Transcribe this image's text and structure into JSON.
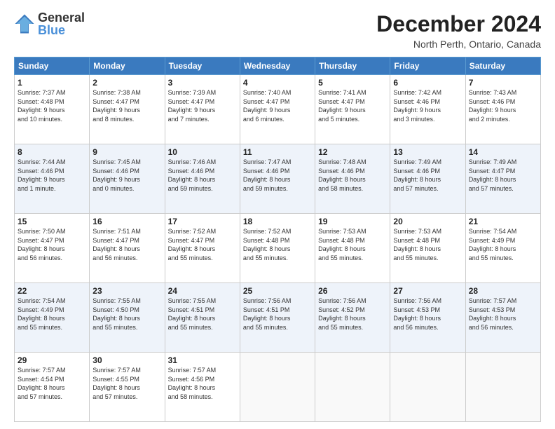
{
  "header": {
    "logo_line1": "General",
    "logo_line2": "Blue",
    "month_title": "December 2024",
    "location": "North Perth, Ontario, Canada"
  },
  "days_of_week": [
    "Sunday",
    "Monday",
    "Tuesday",
    "Wednesday",
    "Thursday",
    "Friday",
    "Saturday"
  ],
  "weeks": [
    [
      {
        "day": "1",
        "lines": [
          "Sunrise: 7:37 AM",
          "Sunset: 4:48 PM",
          "Daylight: 9 hours",
          "and 10 minutes."
        ]
      },
      {
        "day": "2",
        "lines": [
          "Sunrise: 7:38 AM",
          "Sunset: 4:47 PM",
          "Daylight: 9 hours",
          "and 8 minutes."
        ]
      },
      {
        "day": "3",
        "lines": [
          "Sunrise: 7:39 AM",
          "Sunset: 4:47 PM",
          "Daylight: 9 hours",
          "and 7 minutes."
        ]
      },
      {
        "day": "4",
        "lines": [
          "Sunrise: 7:40 AM",
          "Sunset: 4:47 PM",
          "Daylight: 9 hours",
          "and 6 minutes."
        ]
      },
      {
        "day": "5",
        "lines": [
          "Sunrise: 7:41 AM",
          "Sunset: 4:47 PM",
          "Daylight: 9 hours",
          "and 5 minutes."
        ]
      },
      {
        "day": "6",
        "lines": [
          "Sunrise: 7:42 AM",
          "Sunset: 4:46 PM",
          "Daylight: 9 hours",
          "and 3 minutes."
        ]
      },
      {
        "day": "7",
        "lines": [
          "Sunrise: 7:43 AM",
          "Sunset: 4:46 PM",
          "Daylight: 9 hours",
          "and 2 minutes."
        ]
      }
    ],
    [
      {
        "day": "8",
        "lines": [
          "Sunrise: 7:44 AM",
          "Sunset: 4:46 PM",
          "Daylight: 9 hours",
          "and 1 minute."
        ]
      },
      {
        "day": "9",
        "lines": [
          "Sunrise: 7:45 AM",
          "Sunset: 4:46 PM",
          "Daylight: 9 hours",
          "and 0 minutes."
        ]
      },
      {
        "day": "10",
        "lines": [
          "Sunrise: 7:46 AM",
          "Sunset: 4:46 PM",
          "Daylight: 8 hours",
          "and 59 minutes."
        ]
      },
      {
        "day": "11",
        "lines": [
          "Sunrise: 7:47 AM",
          "Sunset: 4:46 PM",
          "Daylight: 8 hours",
          "and 59 minutes."
        ]
      },
      {
        "day": "12",
        "lines": [
          "Sunrise: 7:48 AM",
          "Sunset: 4:46 PM",
          "Daylight: 8 hours",
          "and 58 minutes."
        ]
      },
      {
        "day": "13",
        "lines": [
          "Sunrise: 7:49 AM",
          "Sunset: 4:46 PM",
          "Daylight: 8 hours",
          "and 57 minutes."
        ]
      },
      {
        "day": "14",
        "lines": [
          "Sunrise: 7:49 AM",
          "Sunset: 4:47 PM",
          "Daylight: 8 hours",
          "and 57 minutes."
        ]
      }
    ],
    [
      {
        "day": "15",
        "lines": [
          "Sunrise: 7:50 AM",
          "Sunset: 4:47 PM",
          "Daylight: 8 hours",
          "and 56 minutes."
        ]
      },
      {
        "day": "16",
        "lines": [
          "Sunrise: 7:51 AM",
          "Sunset: 4:47 PM",
          "Daylight: 8 hours",
          "and 56 minutes."
        ]
      },
      {
        "day": "17",
        "lines": [
          "Sunrise: 7:52 AM",
          "Sunset: 4:47 PM",
          "Daylight: 8 hours",
          "and 55 minutes."
        ]
      },
      {
        "day": "18",
        "lines": [
          "Sunrise: 7:52 AM",
          "Sunset: 4:48 PM",
          "Daylight: 8 hours",
          "and 55 minutes."
        ]
      },
      {
        "day": "19",
        "lines": [
          "Sunrise: 7:53 AM",
          "Sunset: 4:48 PM",
          "Daylight: 8 hours",
          "and 55 minutes."
        ]
      },
      {
        "day": "20",
        "lines": [
          "Sunrise: 7:53 AM",
          "Sunset: 4:48 PM",
          "Daylight: 8 hours",
          "and 55 minutes."
        ]
      },
      {
        "day": "21",
        "lines": [
          "Sunrise: 7:54 AM",
          "Sunset: 4:49 PM",
          "Daylight: 8 hours",
          "and 55 minutes."
        ]
      }
    ],
    [
      {
        "day": "22",
        "lines": [
          "Sunrise: 7:54 AM",
          "Sunset: 4:49 PM",
          "Daylight: 8 hours",
          "and 55 minutes."
        ]
      },
      {
        "day": "23",
        "lines": [
          "Sunrise: 7:55 AM",
          "Sunset: 4:50 PM",
          "Daylight: 8 hours",
          "and 55 minutes."
        ]
      },
      {
        "day": "24",
        "lines": [
          "Sunrise: 7:55 AM",
          "Sunset: 4:51 PM",
          "Daylight: 8 hours",
          "and 55 minutes."
        ]
      },
      {
        "day": "25",
        "lines": [
          "Sunrise: 7:56 AM",
          "Sunset: 4:51 PM",
          "Daylight: 8 hours",
          "and 55 minutes."
        ]
      },
      {
        "day": "26",
        "lines": [
          "Sunrise: 7:56 AM",
          "Sunset: 4:52 PM",
          "Daylight: 8 hours",
          "and 55 minutes."
        ]
      },
      {
        "day": "27",
        "lines": [
          "Sunrise: 7:56 AM",
          "Sunset: 4:53 PM",
          "Daylight: 8 hours",
          "and 56 minutes."
        ]
      },
      {
        "day": "28",
        "lines": [
          "Sunrise: 7:57 AM",
          "Sunset: 4:53 PM",
          "Daylight: 8 hours",
          "and 56 minutes."
        ]
      }
    ],
    [
      {
        "day": "29",
        "lines": [
          "Sunrise: 7:57 AM",
          "Sunset: 4:54 PM",
          "Daylight: 8 hours",
          "and 57 minutes."
        ]
      },
      {
        "day": "30",
        "lines": [
          "Sunrise: 7:57 AM",
          "Sunset: 4:55 PM",
          "Daylight: 8 hours",
          "and 57 minutes."
        ]
      },
      {
        "day": "31",
        "lines": [
          "Sunrise: 7:57 AM",
          "Sunset: 4:56 PM",
          "Daylight: 8 hours",
          "and 58 minutes."
        ]
      },
      {
        "day": "",
        "lines": []
      },
      {
        "day": "",
        "lines": []
      },
      {
        "day": "",
        "lines": []
      },
      {
        "day": "",
        "lines": []
      }
    ]
  ]
}
